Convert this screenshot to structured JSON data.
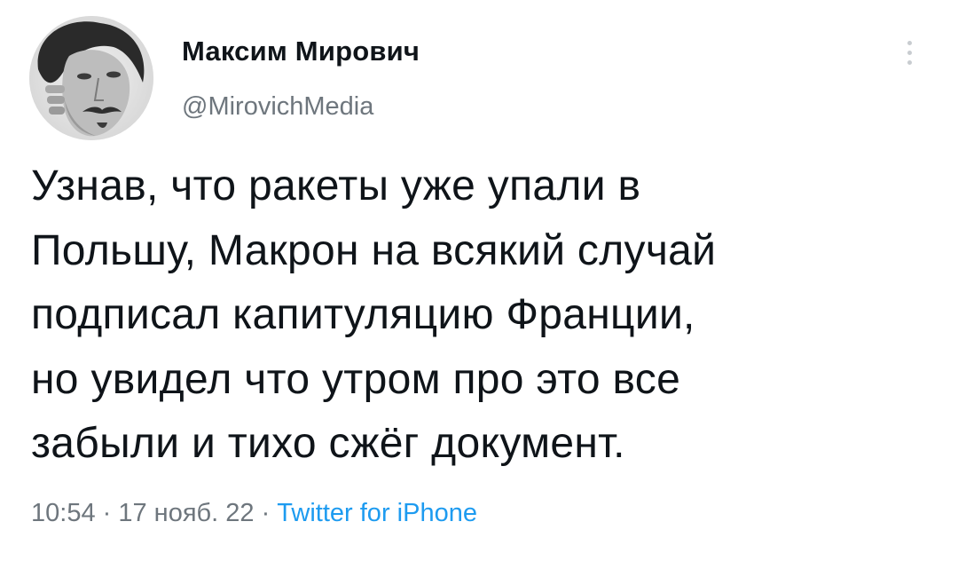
{
  "author": {
    "name": "Максим Мирович",
    "handle": "@MirovichMedia"
  },
  "tweet": {
    "lines": [
      "Узнав, что ракеты уже упали в",
      "Польшу, Макрон на всякий случай",
      "подписал капитуляцию Франции,",
      "но увидел что утром про это все",
      "забыли и тихо сжёг документ."
    ]
  },
  "meta": {
    "time": "10:54",
    "sep1": " · ",
    "date": "17 нояб. 22",
    "sep2": " · ",
    "source": "Twitter for iPhone"
  },
  "icons": {
    "more": "more-vertical-icon"
  },
  "colors": {
    "text": "#0f1419",
    "secondary": "#6e767d",
    "link": "#1d9bf0"
  }
}
